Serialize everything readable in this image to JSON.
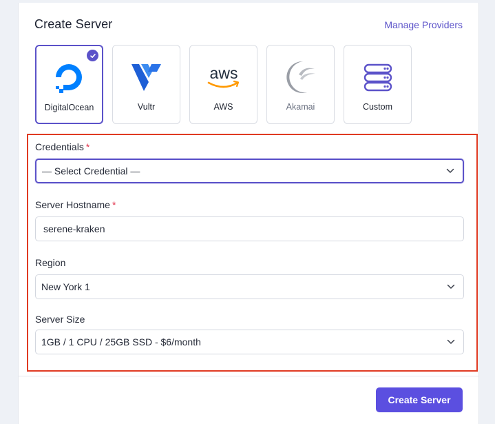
{
  "page": {
    "title": "Create Server",
    "manage_link": "Manage Providers",
    "accent_color": "#5b52c9",
    "error_outline_color": "#e03a22"
  },
  "providers": [
    {
      "name": "DigitalOcean",
      "icon": "digitalocean-logo-icon",
      "selected": true
    },
    {
      "name": "Vultr",
      "icon": "vultr-logo-icon",
      "selected": false
    },
    {
      "name": "AWS",
      "icon": "aws-logo-icon",
      "selected": false
    },
    {
      "name": "Akamai",
      "icon": "akamai-logo-icon",
      "selected": false
    },
    {
      "name": "Custom",
      "icon": "server-stack-icon",
      "selected": false
    }
  ],
  "form": {
    "credentials": {
      "label": "Credentials",
      "required_mark": "*",
      "value": "— Select Credential —"
    },
    "hostname": {
      "label": "Server Hostname",
      "required_mark": "*",
      "value": "serene-kraken"
    },
    "region": {
      "label": "Region",
      "value": "New York 1"
    },
    "size": {
      "label": "Server Size",
      "value": "1GB / 1 CPU / 25GB SSD - $6/month"
    }
  },
  "footer": {
    "submit_label": "Create Server"
  }
}
